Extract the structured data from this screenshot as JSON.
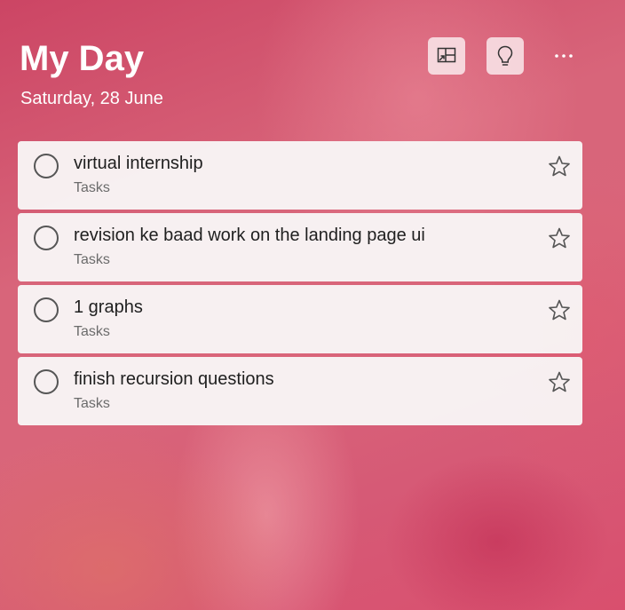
{
  "header": {
    "title": "My Day",
    "date": "Saturday, 28 June"
  },
  "toolbar": {
    "icons": [
      "suggestions-layout-icon",
      "lightbulb-icon",
      "more-options-icon"
    ]
  },
  "tasks": [
    {
      "title": "virtual internship",
      "list": "Tasks",
      "completed": false,
      "important": false
    },
    {
      "title": "revision ke baad work on the landing page ui",
      "list": "Tasks",
      "completed": false,
      "important": false
    },
    {
      "title": "1 graphs",
      "list": "Tasks",
      "completed": false,
      "important": false
    },
    {
      "title": "finish recursion questions",
      "list": "Tasks",
      "completed": false,
      "important": false
    }
  ],
  "colors": {
    "background_accent": "#d65a76",
    "card": "#f8f6f6",
    "text": "#1f1f1f",
    "subtext": "#6b6b6b"
  }
}
